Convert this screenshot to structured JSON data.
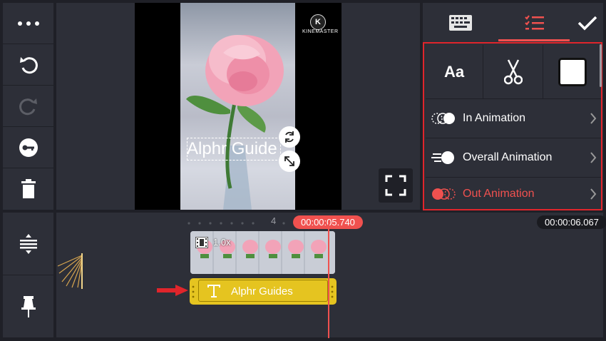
{
  "left_toolbar": {
    "items": [
      "more-icon",
      "undo-icon",
      "redo-icon",
      "keyframe-icon",
      "delete-icon"
    ]
  },
  "left_bottom": {
    "items": [
      "align-icon",
      "pin-icon"
    ]
  },
  "preview": {
    "watermark": "KINEMASTER",
    "overlay_text": "Alphr Guide"
  },
  "right_panel": {
    "tabs": [
      "keyboard-icon",
      "options-icon",
      "check-icon"
    ],
    "tools": [
      "Aa"
    ],
    "animations": [
      {
        "label": "In Animation",
        "active": false
      },
      {
        "label": "Overall Animation",
        "active": false
      },
      {
        "label": "Out Animation",
        "active": true
      }
    ],
    "accent": "#f0514f"
  },
  "timeline": {
    "current_time": "00:00:05.740",
    "total_time": "00:00:06.067",
    "ruler_mark": "4",
    "video_clip_speed": "1.0x",
    "text_clip_label": "Alphr Guides",
    "text_clip_color": "#e5c420"
  }
}
